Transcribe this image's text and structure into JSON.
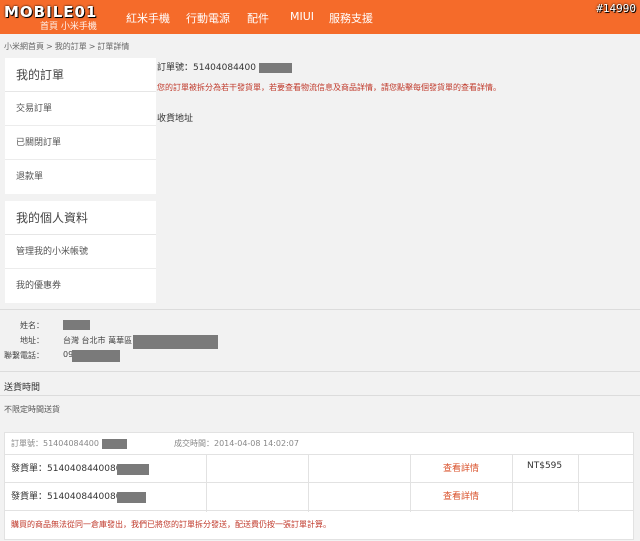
{
  "header": {
    "logo_main": "MOBILE01",
    "logo_sub": "首頁  小米手機",
    "nav": [
      "紅米手機",
      "行動電源",
      "配件",
      "MIUI",
      "服務支援"
    ],
    "id_tag": "#14990"
  },
  "breadcrumb": [
    "小米網首頁",
    "我的訂單",
    "訂單詳情"
  ],
  "sidebar": {
    "orders": {
      "title": "我的訂單",
      "items": [
        "交易訂單",
        "已關閉訂單",
        "退款單"
      ]
    },
    "profile": {
      "title": "我的個人資料",
      "items": [
        "管理我的小米帳號",
        "我的優惠券"
      ]
    }
  },
  "order": {
    "number_label": "訂單號：51404084400",
    "notice": "您的訂單被拆分為若干發貨單，若要查看物流信息及商品詳情，請您點擊每個發貨單的查看詳情。",
    "address_title": "收貨地址"
  },
  "recipient": {
    "name_label": "姓名：",
    "address_label": "地址：",
    "address_value": "台灣 台北市 萬華區",
    "phone_label": "聯繫電話：",
    "phone_value": "09"
  },
  "delivery": {
    "title": "送貨時間",
    "value": "不限定時間送貨"
  },
  "table": {
    "order_no": "訂單號：51404084400",
    "deal_time": "成交時間：2014-04-08 14:02:07",
    "rows": [
      {
        "shipment": "發貨單：5140408440080",
        "action": "查看詳情"
      },
      {
        "shipment": "發貨單：5140408440080",
        "action": "查看詳情"
      }
    ],
    "price": "NT$595",
    "footer_note": "購買的商品無法從同一倉庫發出，我們已將您的訂單拆分發送，配送費仍按一張訂單計算。"
  },
  "colors": {
    "brand": "#f56b2a",
    "link": "#d9502a",
    "notice": "#c0392b"
  }
}
